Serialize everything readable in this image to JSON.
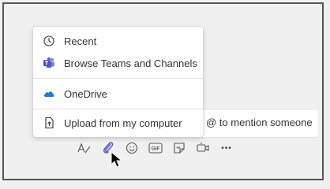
{
  "attach_menu": {
    "items": [
      {
        "label": "Recent",
        "icon": "clock-icon"
      },
      {
        "label": "Browse Teams and Channels",
        "icon": "teams-icon"
      },
      {
        "label": "OneDrive",
        "icon": "onedrive-icon"
      },
      {
        "label": "Upload from my computer",
        "icon": "upload-icon"
      }
    ]
  },
  "compose": {
    "placeholder_visible": "@ to mention someone"
  },
  "toolbar": {
    "icons": [
      "format-icon",
      "attach-icon",
      "emoji-icon",
      "gif-icon",
      "sticker-icon",
      "meet-now-icon",
      "more-icon"
    ],
    "gif_text": "GIF",
    "more_text": "•••"
  },
  "colors": {
    "teams_purple": "#5b5fc7",
    "onedrive_blue": "#1c7ad8",
    "text": "#333333"
  }
}
